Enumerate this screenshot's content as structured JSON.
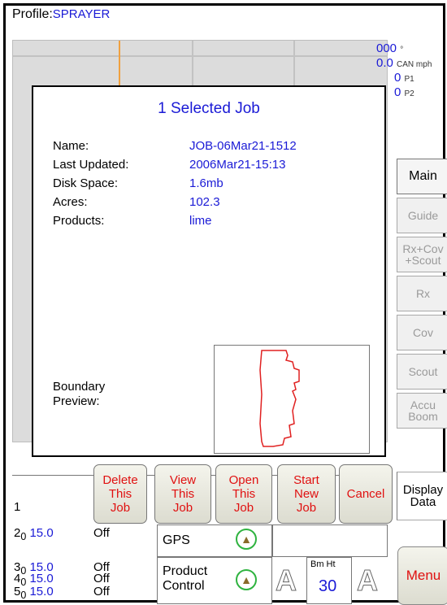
{
  "header": {
    "profile_label": "Profile:",
    "profile_value": "SPRAYER"
  },
  "readouts": [
    {
      "value": "000",
      "unit": "°"
    },
    {
      "value": "0.0",
      "unit": "CAN mph"
    },
    {
      "value": "0",
      "unit": "P1"
    },
    {
      "value": "0",
      "unit": "P2"
    }
  ],
  "sidebar": {
    "items": [
      {
        "label": "Main",
        "state": "active"
      },
      {
        "label": "Guide",
        "state": "disabled"
      },
      {
        "label": "Rx+Cov\n+Scout",
        "state": "disabled"
      },
      {
        "label": "Rx",
        "state": "disabled"
      },
      {
        "label": "Cov",
        "state": "disabled"
      },
      {
        "label": "Scout",
        "state": "disabled"
      },
      {
        "label": "Accu\nBoom",
        "state": "disabled"
      }
    ],
    "display_data": "Display\nData"
  },
  "dialog": {
    "title": "1 Selected Job",
    "fields": [
      {
        "label": "Name:",
        "value": "JOB-06Mar21-1512"
      },
      {
        "label": "Last Updated:",
        "value": "2006Mar21-15:13"
      },
      {
        "label": "Disk Space:",
        "value": "1.6mb"
      },
      {
        "label": "Acres:",
        "value": "102.3"
      },
      {
        "label": "Products:",
        "value": "lime"
      }
    ],
    "boundary_label_1": "Boundary",
    "boundary_label_2": "Preview:",
    "buttons": [
      {
        "label": "Delete\nThis\nJob"
      },
      {
        "label": "View\nThis\nJob"
      },
      {
        "label": "Open\nThis\nJob"
      },
      {
        "label": "Start\nNew\nJob"
      },
      {
        "label": "Cancel"
      }
    ]
  },
  "sections": [
    {
      "num": "1",
      "sub": "",
      "rate": "",
      "state": ""
    },
    {
      "num": "2",
      "sub": "0",
      "rate": "15.0",
      "state": "Off"
    },
    {
      "num": "3",
      "sub": "0",
      "rate": "15.0",
      "state": "Off"
    },
    {
      "num": "4",
      "sub": "0",
      "rate": "15.0",
      "state": "Off"
    },
    {
      "num": "5",
      "sub": "0",
      "rate": "15.0",
      "state": "Off"
    }
  ],
  "status": {
    "gps": "GPS",
    "product_control_1": "Product",
    "product_control_2": "Control",
    "bm_ht_label": "Bm Ht",
    "bm_ht_value": "30",
    "auto_icon": "A"
  },
  "menu": {
    "label": "Menu"
  },
  "colors": {
    "accent_blue": "#1a1ad6",
    "button_red": "#e01010",
    "boundary_red": "#e02020",
    "status_green": "#2fb340"
  }
}
